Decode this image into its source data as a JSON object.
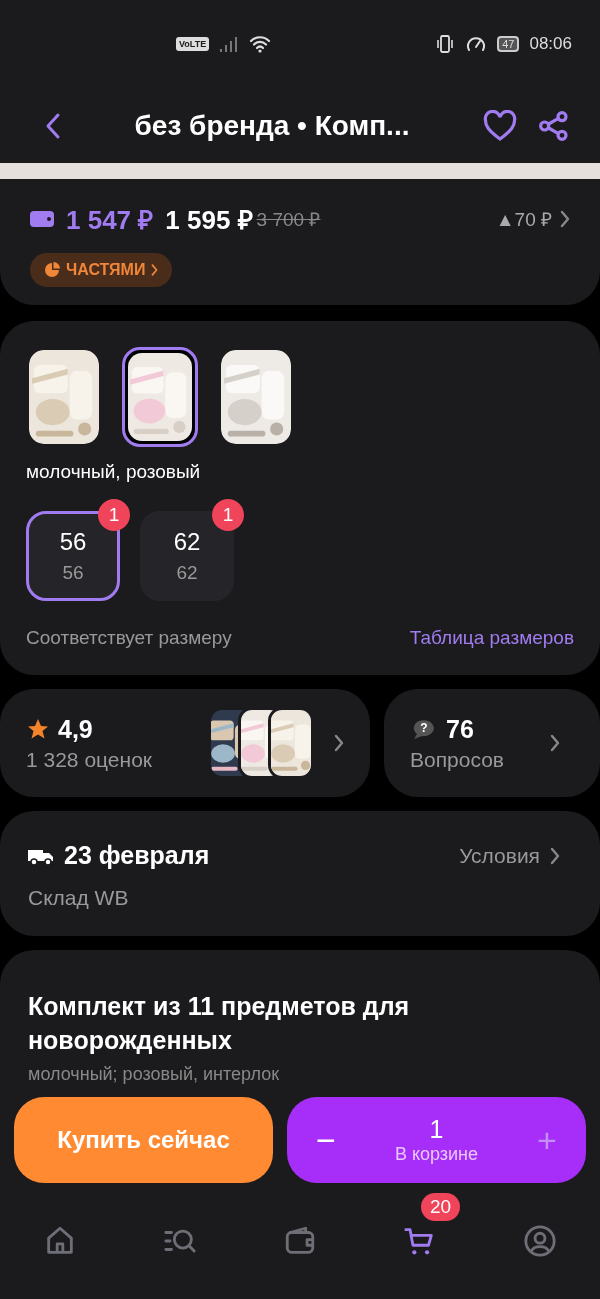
{
  "status_bar": {
    "volte": "VoLTE",
    "battery": "47",
    "time": "08:06"
  },
  "header": {
    "title": "без бренда • Комп...",
    "favorite": false
  },
  "price": {
    "wallet_price": "1 547 ₽",
    "price": "1 595 ₽",
    "old_price": "3 700 ₽",
    "change": "▲70 ₽",
    "installments": "ЧАСТЯМИ"
  },
  "variants": {
    "thumbnails": [
      {
        "selected": false
      },
      {
        "selected": true
      },
      {
        "selected": false
      }
    ],
    "color_name": "молочный, розовый",
    "sizes": [
      {
        "size": "56",
        "ru_size": "56",
        "badge": "1",
        "selected": true
      },
      {
        "size": "62",
        "ru_size": "62",
        "badge": "1",
        "selected": false
      }
    ],
    "fit": "Соответствует размеру",
    "size_table": "Таблица размеров"
  },
  "rating": {
    "score": "4,9",
    "count": "1 328 оценок"
  },
  "questions": {
    "icon": "?",
    "count": "76",
    "label": "Вопросов"
  },
  "delivery": {
    "date": "23 февраля",
    "conditions": "Условия",
    "warehouse": "Склад WB"
  },
  "description": {
    "title": "Комплект из 11 предметов для новорожденных",
    "subtitle": "молочный; розовый, интерлок"
  },
  "actions": {
    "buy": "Купить сейчас",
    "quantity": "1",
    "in_cart": "В корзине",
    "minus": "−",
    "plus": "+"
  },
  "nav": [
    {
      "kind": "home",
      "selected": false
    },
    {
      "kind": "catalog",
      "selected": false
    },
    {
      "kind": "wallet",
      "selected": false
    },
    {
      "kind": "cart",
      "selected": true,
      "badge": "20"
    },
    {
      "kind": "profile",
      "selected": false
    }
  ]
}
